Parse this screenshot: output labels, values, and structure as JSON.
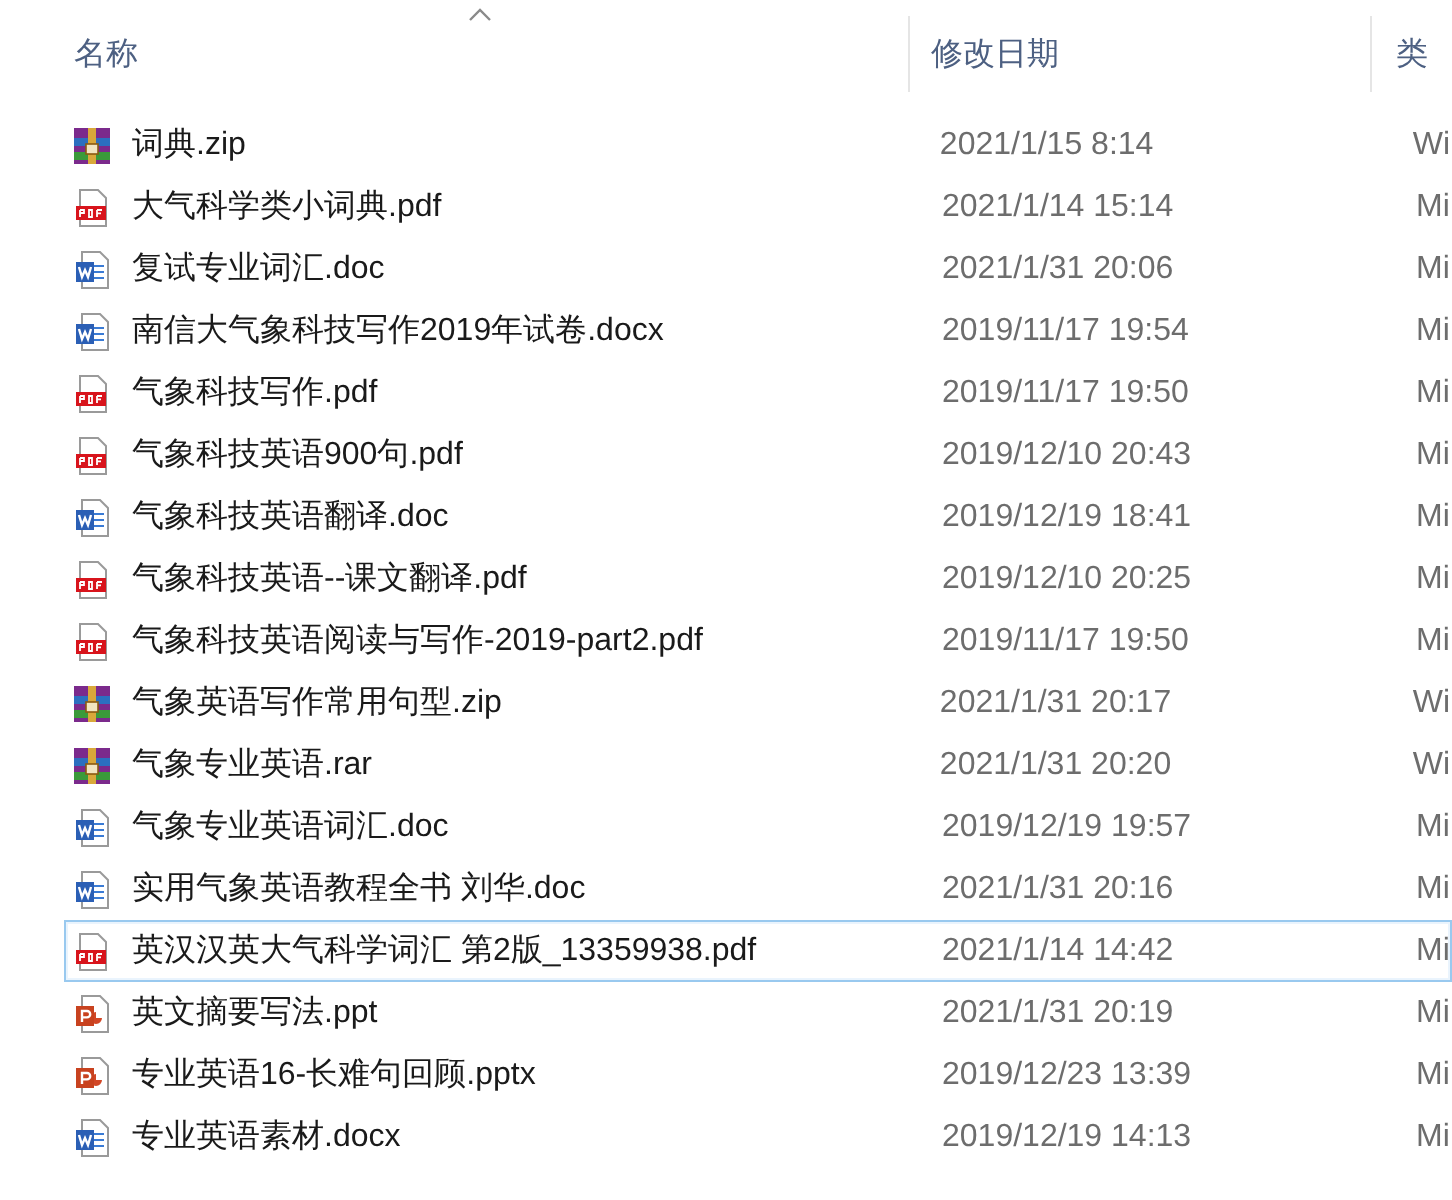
{
  "header": {
    "columns": [
      {
        "label": "名称",
        "sorted": true
      },
      {
        "label": "修改日期",
        "sorted": false
      },
      {
        "label": "类",
        "sorted": false
      }
    ]
  },
  "files": [
    {
      "kind": "zip",
      "name": "词典.zip",
      "modified": "2021/1/15 8:14",
      "type": "Wi",
      "selected": false
    },
    {
      "kind": "pdf",
      "name": "大气科学类小词典.pdf",
      "modified": "2021/1/14 15:14",
      "type": "Mi",
      "selected": false
    },
    {
      "kind": "doc",
      "name": "复试专业词汇.doc",
      "modified": "2021/1/31 20:06",
      "type": "Mi",
      "selected": false
    },
    {
      "kind": "doc",
      "name": "南信大气象科技写作2019年试卷.docx",
      "modified": "2019/11/17 19:54",
      "type": "Mi",
      "selected": false
    },
    {
      "kind": "pdf",
      "name": "气象科技写作.pdf",
      "modified": "2019/11/17 19:50",
      "type": "Mi",
      "selected": false
    },
    {
      "kind": "pdf",
      "name": "气象科技英语900句.pdf",
      "modified": "2019/12/10 20:43",
      "type": "Mi",
      "selected": false
    },
    {
      "kind": "doc",
      "name": "气象科技英语翻译.doc",
      "modified": "2019/12/19 18:41",
      "type": "Mi",
      "selected": false
    },
    {
      "kind": "pdf",
      "name": "气象科技英语--课文翻译.pdf",
      "modified": "2019/12/10 20:25",
      "type": "Mi",
      "selected": false
    },
    {
      "kind": "pdf",
      "name": "气象科技英语阅读与写作-2019-part2.pdf",
      "modified": "2019/11/17 19:50",
      "type": "Mi",
      "selected": false
    },
    {
      "kind": "zip",
      "name": "气象英语写作常用句型.zip",
      "modified": "2021/1/31 20:17",
      "type": "Wi",
      "selected": false
    },
    {
      "kind": "zip",
      "name": "气象专业英语.rar",
      "modified": "2021/1/31 20:20",
      "type": "Wi",
      "selected": false
    },
    {
      "kind": "doc",
      "name": "气象专业英语词汇.doc",
      "modified": "2019/12/19 19:57",
      "type": "Mi",
      "selected": false
    },
    {
      "kind": "doc",
      "name": "实用气象英语教程全书 刘华.doc",
      "modified": "2021/1/31 20:16",
      "type": "Mi",
      "selected": false
    },
    {
      "kind": "pdf",
      "name": "英汉汉英大气科学词汇 第2版_13359938.pdf",
      "modified": "2021/1/14 14:42",
      "type": "Mi",
      "selected": true
    },
    {
      "kind": "ppt",
      "name": "英文摘要写法.ppt",
      "modified": "2021/1/31 20:19",
      "type": "Mi",
      "selected": false
    },
    {
      "kind": "ppt",
      "name": "专业英语16-长难句回顾.pptx",
      "modified": "2019/12/23 13:39",
      "type": "Mi",
      "selected": false
    },
    {
      "kind": "doc",
      "name": "专业英语素材.docx",
      "modified": "2019/12/19 14:13",
      "type": "Mi",
      "selected": false
    }
  ]
}
